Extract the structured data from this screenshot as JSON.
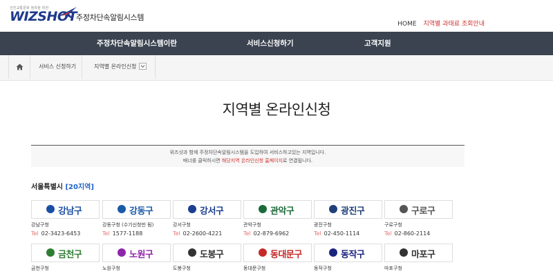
{
  "header": {
    "logo_tagline": "선진교통문화 정착을 위한",
    "logo_brand": "WIZSHOT",
    "logo_system": "주정차단속알림시스템",
    "home_link": "HOME",
    "fine_link": "지역별 과태료 조회안내"
  },
  "gnb": [
    "주정차단속알림시스템이란",
    "서비스신청하기",
    "고객지원"
  ],
  "breadcrumb": {
    "level1": "서비스 신청하기",
    "level2": "지역별 온라인신청"
  },
  "page_title": "지역별 온라인신청",
  "notice": {
    "line1": "위즈샷과 함께 주정차단속알림시스템을 도입하여 서비스하고있는 지역입니다.",
    "line2_pre": "배너를 클릭하시면 ",
    "line2_red": "해당지역 온라인신청 홈페이지",
    "line2_post": "로 연결됩니다."
  },
  "region": {
    "name": "서울특별시",
    "count": "[20지역]"
  },
  "tel_label": "Tel",
  "districts": [
    {
      "logo": "강남구",
      "office": "강남구청",
      "tel": "02-3423-6453",
      "color": "#1b4fa3"
    },
    {
      "logo": "강동구",
      "office": "강동구청 (수기신청만 됨)",
      "tel": "1577-1188",
      "color": "#1a5aa8"
    },
    {
      "logo": "강서구",
      "office": "강서구청",
      "tel": "02-2600-4221",
      "color": "#1c3f8f"
    },
    {
      "logo": "관악구",
      "office": "관악구청",
      "tel": "02-879-6962",
      "color": "#1d6b3a"
    },
    {
      "logo": "광진구",
      "office": "광진구청",
      "tel": "02-450-1114",
      "color": "#20407a"
    },
    {
      "logo": "구로구",
      "office": "구로구청",
      "tel": "02-860-2114",
      "color": "#555555"
    },
    {
      "logo": "금천구",
      "office": "금천구청",
      "color": "#2e7d32"
    },
    {
      "logo": "노원구",
      "office": "노원구청",
      "color": "#8e24aa"
    },
    {
      "logo": "도봉구",
      "office": "도봉구청",
      "color": "#333333"
    },
    {
      "logo": "동대문구",
      "office": "동대문구청",
      "color": "#c62828"
    },
    {
      "logo": "동작구",
      "office": "동작구청",
      "color": "#1a237e"
    },
    {
      "logo": "마포구",
      "office": "마포구청",
      "color": "#333333"
    }
  ]
}
